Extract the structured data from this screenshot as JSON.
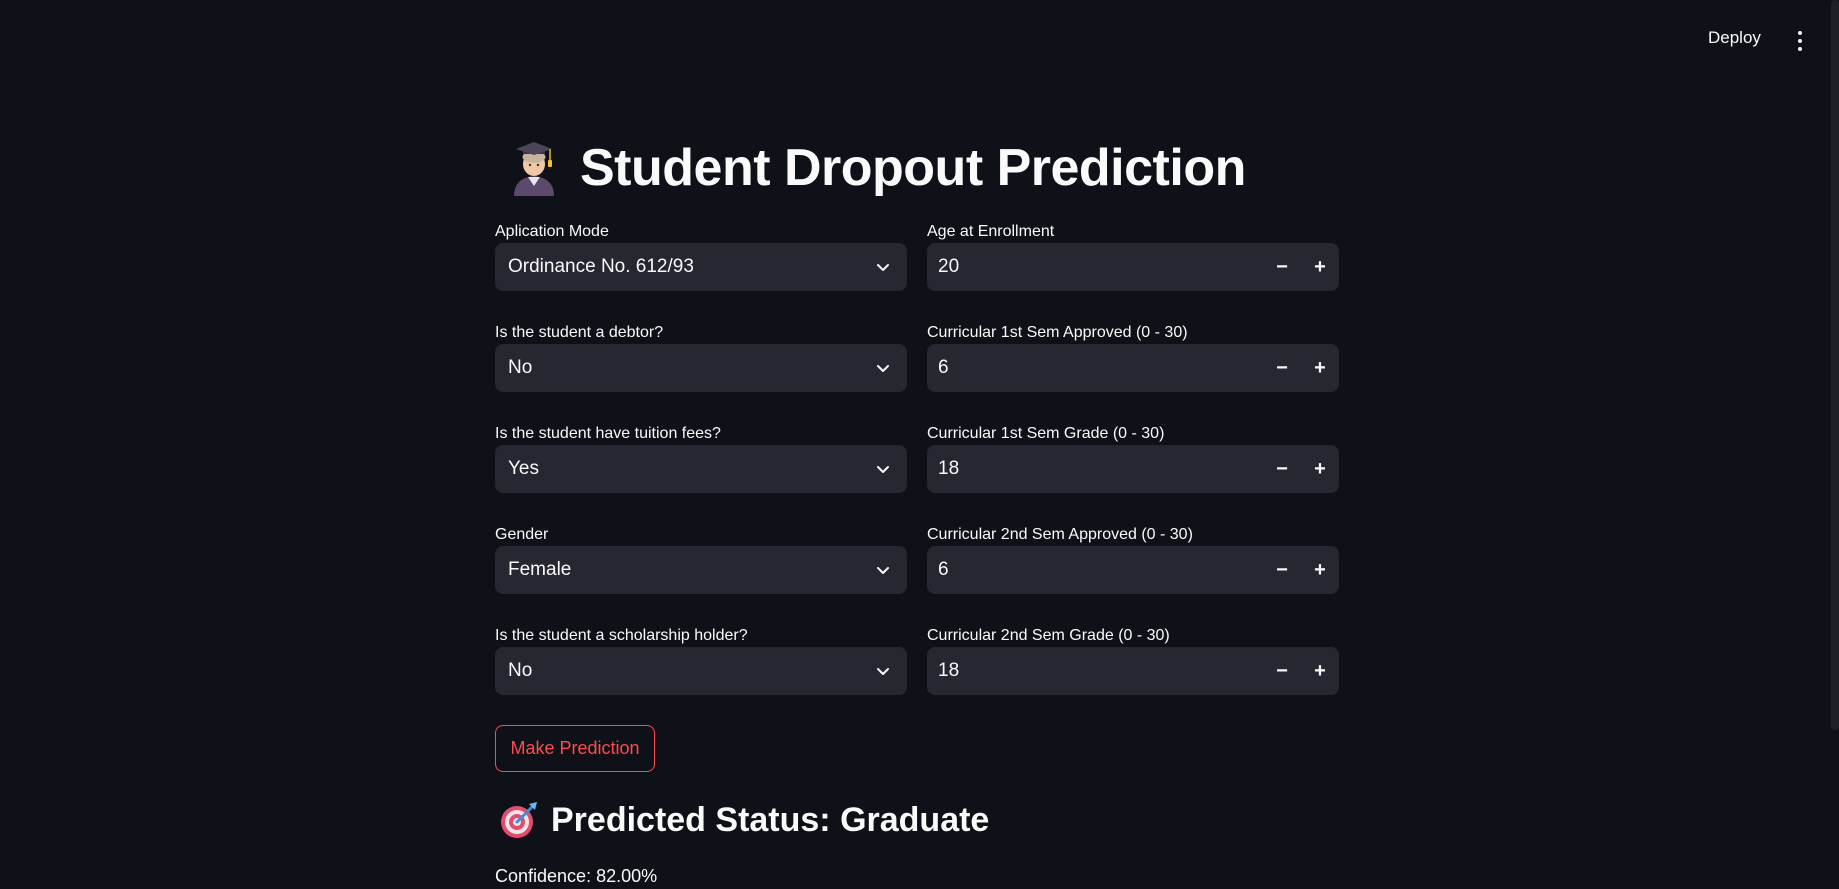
{
  "header": {
    "deploy_label": "Deploy",
    "menu_icon": "vertical-ellipsis-icon"
  },
  "page": {
    "title_emoji": "graduate-icon",
    "title": "Student Dropout Prediction"
  },
  "left_fields": [
    {
      "label": "Aplication Mode",
      "value": "Ordinance No. 612/93"
    },
    {
      "label": "Is the student a debtor?",
      "value": "No"
    },
    {
      "label": "Is the student have tuition fees?",
      "value": "Yes"
    },
    {
      "label": "Gender",
      "value": "Female"
    },
    {
      "label": "Is the student a scholarship holder?",
      "value": "No"
    }
  ],
  "right_fields": [
    {
      "label": "Age at Enrollment",
      "value": "20"
    },
    {
      "label": "Curricular 1st Sem Approved (0 - 30)",
      "value": "6"
    },
    {
      "label": "Curricular 1st Sem Grade (0 - 30)",
      "value": "18"
    },
    {
      "label": "Curricular 2nd Sem Approved (0 - 30)",
      "value": "6"
    },
    {
      "label": "Curricular 2nd Sem Grade (0 - 30)",
      "value": "18"
    }
  ],
  "stepper": {
    "minus": "−",
    "plus": "+"
  },
  "action": {
    "predict_label": "Make Prediction"
  },
  "result": {
    "icon": "target-icon",
    "status_text": "Predicted Status: Graduate",
    "confidence_text": "Confidence: 82.00%"
  },
  "colors": {
    "background": "#0e1117",
    "input_bg": "#262730",
    "accent": "#ff4b4b",
    "text": "#fafafa"
  }
}
